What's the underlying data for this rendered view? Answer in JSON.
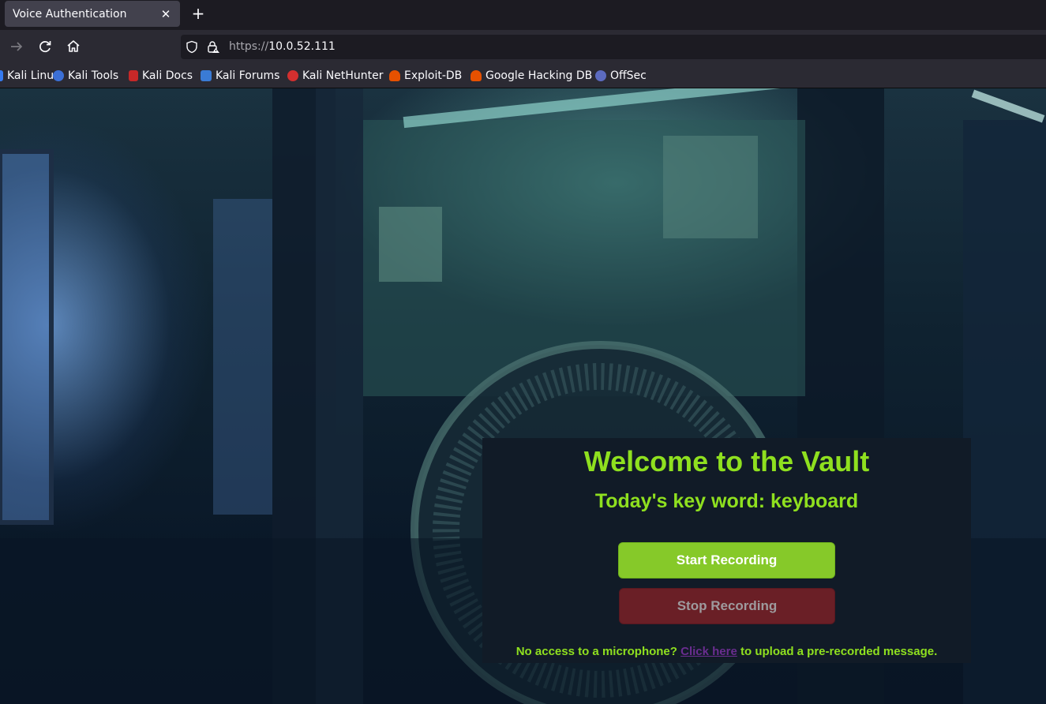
{
  "browser": {
    "tab_title": "Voice Authentication",
    "url_scheme": "https://",
    "url_host": "10.0.52.111",
    "bookmarks": [
      {
        "label": "Kali Linux",
        "icon": "kali-linux-icon",
        "color": "#367bf0"
      },
      {
        "label": "Kali Tools",
        "icon": "kali-tools-icon",
        "color": "#3b6fd6"
      },
      {
        "label": "Kali Docs",
        "icon": "kali-docs-icon",
        "color": "#c62828"
      },
      {
        "label": "Kali Forums",
        "icon": "kali-forums-icon",
        "color": "#3a7bd5"
      },
      {
        "label": "Kali NetHunter",
        "icon": "kali-nethunter-icon",
        "color": "#d32f2f"
      },
      {
        "label": "Exploit-DB",
        "icon": "exploit-db-icon",
        "color": "#e65100"
      },
      {
        "label": "Google Hacking DB",
        "icon": "google-hacking-db-icon",
        "color": "#e65100"
      },
      {
        "label": "OffSec",
        "icon": "offsec-icon",
        "color": "#5c6bc0"
      }
    ]
  },
  "vault": {
    "title": "Welcome to the Vault",
    "subtitle": "Today's key word: keyboard",
    "start_label": "Start Recording",
    "stop_label": "Stop Recording",
    "footer_before": "No access to a microphone?",
    "footer_link": "Click here",
    "footer_after": "to upload a pre-recorded message."
  },
  "colors": {
    "accent_green": "#8fe01f",
    "start_button": "#86c929",
    "stop_button": "#6a1f26",
    "link": "#6a2d8f"
  }
}
